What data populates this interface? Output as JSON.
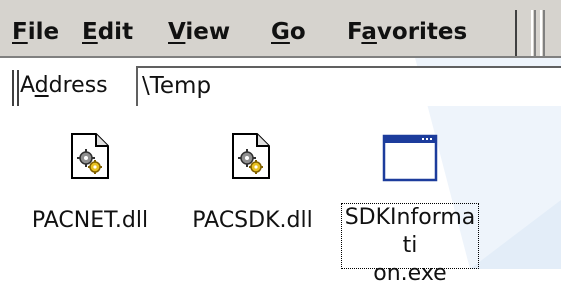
{
  "menu": {
    "file": {
      "hotkey": "F",
      "rest": "ile"
    },
    "edit": {
      "hotkey": "E",
      "rest": "dit"
    },
    "view": {
      "hotkey": "V",
      "rest": "iew"
    },
    "go": {
      "hotkey": "G",
      "rest": "o"
    },
    "favorites": {
      "pre": "F",
      "hotkey": "a",
      "rest": "vorites"
    }
  },
  "address": {
    "label_pre": "A",
    "label_hotkey": "d",
    "label_rest": "dress",
    "value": "\\Temp"
  },
  "files": [
    {
      "name": "PACNET.dll",
      "icon": "dll-gear-icon",
      "selected": false
    },
    {
      "name": "PACSDK.dll",
      "icon": "dll-gear-icon",
      "selected": false
    },
    {
      "name_line1": "SDKInformati",
      "name_line2": "on.exe",
      "icon": "exe-window-icon",
      "selected": true
    }
  ],
  "colors": {
    "toolbar": "#d6d3ce",
    "background_band": "#e8f0fa",
    "exe_icon_titlebar": "#1c3c9c"
  }
}
